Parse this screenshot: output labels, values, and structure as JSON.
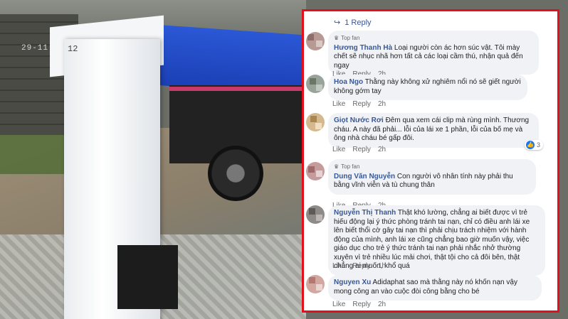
{
  "video": {
    "timestamp": "29-11",
    "camera_label": "12"
  },
  "panel": {
    "replies_link": "1 Reply",
    "colors": {
      "border": "#e3101c",
      "name": "#385898",
      "bubble": "#f0f2f5"
    }
  },
  "comments": [
    {
      "badge": "Top fan",
      "name": "Hương Thanh Hà",
      "text": "Loại người còn ác hơn súc vật. Tôi mày chết sẽ nhục nhã hơn tất cả các loại cầm thú, nhận quả đến ngay",
      "like": "Like",
      "reply": "Reply",
      "time": "2h"
    },
    {
      "badge": "",
      "name": "Hoa Ngo",
      "text": "Thằng này không xử nghiêm nổi nó sẽ giết người không gớm tay",
      "like": "Like",
      "reply": "Reply",
      "time": "2h"
    },
    {
      "badge": "",
      "name": "Giọt Nước Rơi",
      "text": "Đêm qua xem cái clip mà rùng mình. Thương cháu. A này đã phải... lỗi của lái xe 1 phần, lỗi của bố mẹ và ông nhà cháu bé gấp đôi.",
      "like": "Like",
      "reply": "Reply",
      "time": "2h",
      "reactions": "3"
    },
    {
      "badge": "Top fan",
      "name": "Dung Văn Nguyễn",
      "text": "Con người vô nhân tính này phải thu bằng vĩnh viễn và tù chung thân",
      "like": "Like",
      "reply": "Reply",
      "time": "2h"
    },
    {
      "badge": "",
      "name": "Nguyễn Thị Thanh",
      "text": "Thật khó lường, chẳng ai biết được vì trẻ hiếu động lại ý thức phòng tránh tai nạn, chỉ có điều anh lái xe lên biết thổi cờ gây tai nạn thì phải chịu trách nhiệm với hành động của mình, anh lái xe cũng chẳng bao giờ muốn vậy, việc giáo dục cho trẻ ý thức tránh tai nạn phải nhắc nhở thường xuyên vì trẻ nhiều lúc mải chơi, thật tội cho cả đôi bên, thật chẳng ai muốn, khổ quá",
      "like": "Like",
      "reply": "Reply",
      "time": "1h"
    },
    {
      "badge": "",
      "name": "Nguyen Xu",
      "text": "Adidaphat sao mà thằng này nó khốn nạn vậy mong công an vào cuộc đòi công bằng cho bé",
      "like": "Like",
      "reply": "Reply",
      "time": "2h"
    }
  ]
}
